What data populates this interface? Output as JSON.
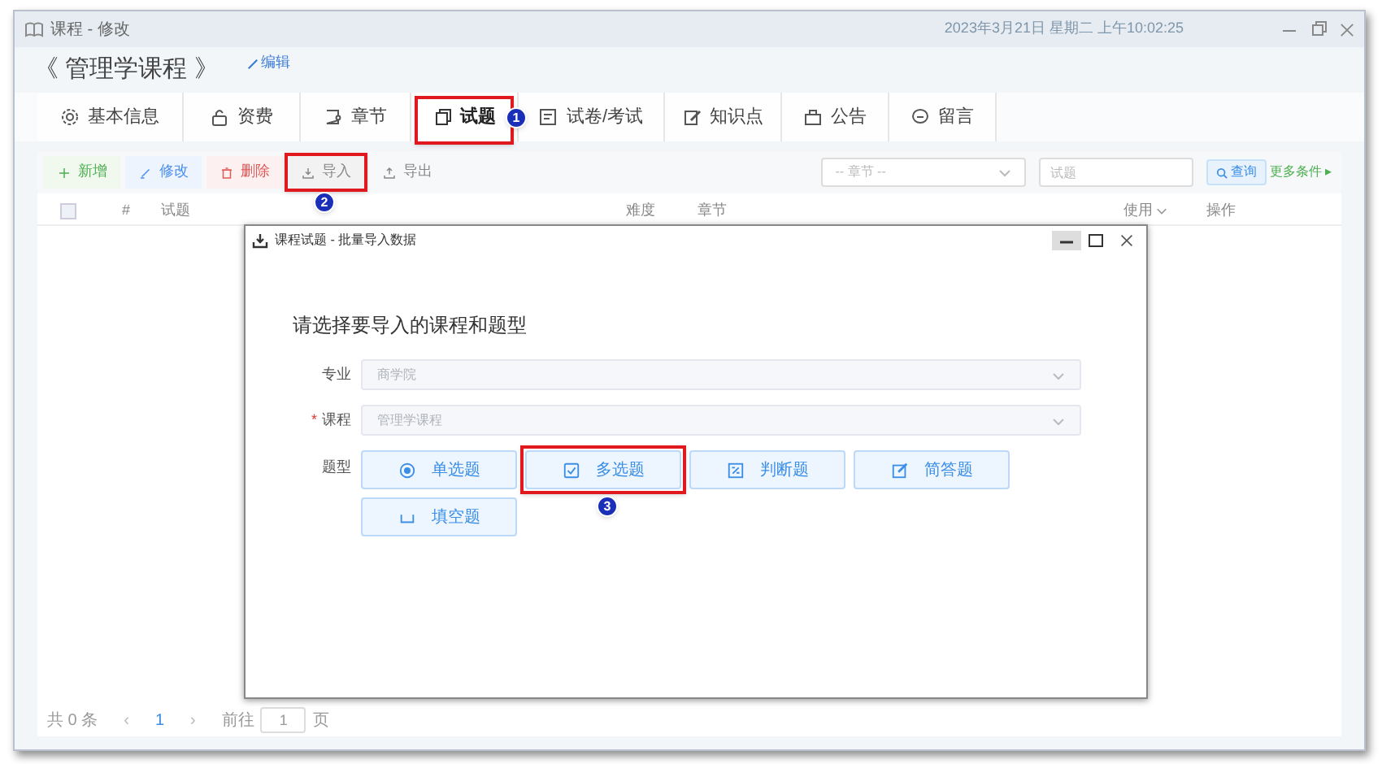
{
  "window": {
    "title": "课程 - 修改"
  },
  "course": {
    "title": "《 管理学课程 》",
    "edit_link": "编辑"
  },
  "background_date": "2023年3月21日 星期二 上午10:02:25",
  "tabs": [
    {
      "label": "基本信息",
      "selected": false
    },
    {
      "label": "资费",
      "selected": false
    },
    {
      "label": "章节",
      "selected": false
    },
    {
      "label": "试题",
      "selected": true,
      "callout": "1"
    },
    {
      "label": "试卷/考试",
      "selected": false
    },
    {
      "label": "知识点",
      "selected": false
    },
    {
      "label": "公告",
      "selected": false
    },
    {
      "label": "留言",
      "selected": false
    }
  ],
  "toolbar": [
    {
      "label": "新增",
      "kind": "add"
    },
    {
      "label": "修改",
      "kind": "edit"
    },
    {
      "label": "删除",
      "kind": "delete"
    },
    {
      "label": "导入",
      "kind": "import",
      "callout": "2"
    },
    {
      "label": "导出",
      "kind": "export"
    }
  ],
  "filters": {
    "chapter_placeholder": "-- 章节 --",
    "search_placeholder": "试题",
    "search_button": "查询",
    "more_link": "更多条件 ▸"
  },
  "table": {
    "select_all_checked": false,
    "columns": [
      "#",
      "试题",
      "难度",
      "章节",
      "使用",
      "操作"
    ]
  },
  "pagination": {
    "total": "共 0 条",
    "prev": "‹",
    "page": "1",
    "next": "›",
    "goto": "前往",
    "page_input": "1",
    "suffix": "页"
  },
  "dialog": {
    "title": "课程试题 - 批量导入数据",
    "heading": "请选择要导入的课程和题型",
    "fields": [
      {
        "label": "专业",
        "value": "商学院"
      },
      {
        "label": "课程",
        "value": "管理学课程",
        "required_mark": "*"
      }
    ],
    "type_label": "题型",
    "types": [
      {
        "label": "单选题"
      },
      {
        "label": "多选题",
        "callout": "3"
      },
      {
        "label": "判断题"
      },
      {
        "label": "简答题"
      },
      {
        "label": "填空题"
      }
    ]
  }
}
